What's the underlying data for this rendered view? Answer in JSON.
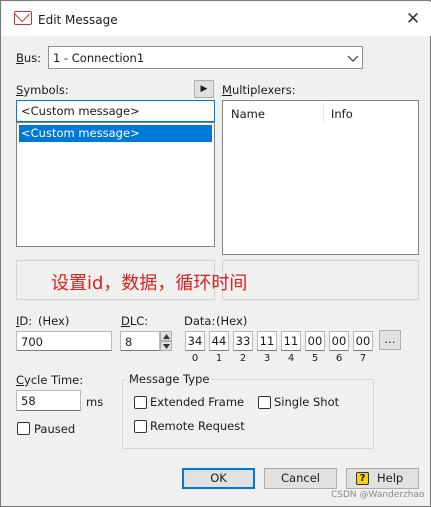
{
  "window": {
    "title": "Edit Message",
    "close_glyph": "✕"
  },
  "bus": {
    "label": "Bus:",
    "value": "1 - Connection1"
  },
  "symbols": {
    "label": "Symbols:",
    "input_value": "<Custom message>",
    "list_items": [
      "<Custom message>"
    ],
    "arrow_glyph": "▶"
  },
  "multiplexers": {
    "label": "Multiplexers:",
    "columns": [
      "Name",
      "Info"
    ]
  },
  "annotation": "设置id，数据，循环时间",
  "id_field": {
    "label": "ID:",
    "format": "(Hex)",
    "value": "700"
  },
  "dlc_field": {
    "label": "DLC:",
    "value": "8"
  },
  "data_field": {
    "label": "Data:",
    "format": "(Hex)",
    "bytes": [
      "34",
      "44",
      "33",
      "11",
      "11",
      "00",
      "00",
      "00"
    ],
    "indices": [
      "0",
      "1",
      "2",
      "3",
      "4",
      "5",
      "6",
      "7"
    ],
    "more_label": "..."
  },
  "cycle": {
    "label": "Cycle Time:",
    "value": "58",
    "unit": "ms",
    "paused_label": "Paused"
  },
  "message_type": {
    "title": "Message Type",
    "extended_frame": "Extended Frame",
    "single_shot": "Single Shot",
    "remote_request": "Remote Request"
  },
  "buttons": {
    "ok": "OK",
    "cancel": "Cancel",
    "help": "Help",
    "help_icon_glyph": "?"
  },
  "watermark": "CSDN @Wanderzhao",
  "colors": {
    "selection": "#0078d7",
    "annotation": "#e02020",
    "help_icon": "#f2d21b"
  }
}
